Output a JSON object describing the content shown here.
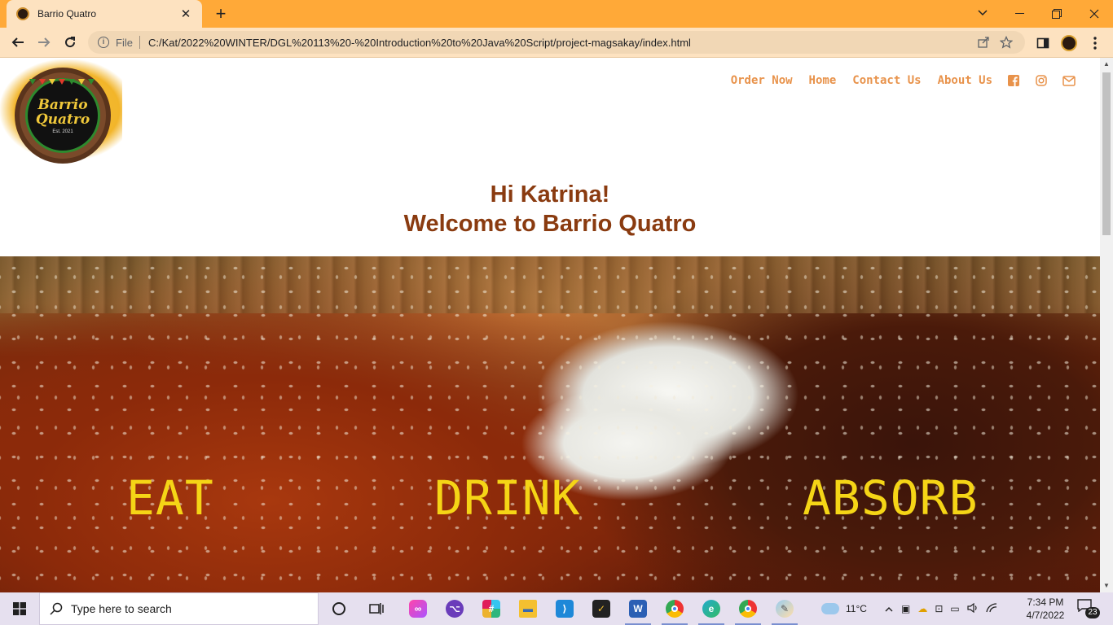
{
  "browser": {
    "tab_title": "Barrio Quatro",
    "new_tab": "+",
    "address_scheme": "File",
    "url": "C:/Kat/2022%20WINTER/DGL%20113%20-%20Introduction%20to%20Java%20Script/project-magsakay/index.html"
  },
  "site": {
    "logo": {
      "line1": "Barrio",
      "line2": "Quatro",
      "est": "Est. 2021"
    },
    "nav": {
      "order": "Order Now",
      "home": "Home",
      "contact": "Contact Us",
      "about": "About Us"
    },
    "greeting_line1": "Hi Katrina!",
    "greeting_line2": "Welcome to Barrio Quatro",
    "hero_words": [
      "EAT",
      "DRINK",
      "ABSORB"
    ]
  },
  "taskbar": {
    "search_placeholder": "Type here to search",
    "weather": "11°C",
    "time": "7:34 PM",
    "date": "4/7/2022",
    "notification_count": "23"
  },
  "colors": {
    "chrome_orange": "#ffa938",
    "nav_link": "#e8924a",
    "greeting": "#8a3b10",
    "hero_text": "#f5d516"
  }
}
